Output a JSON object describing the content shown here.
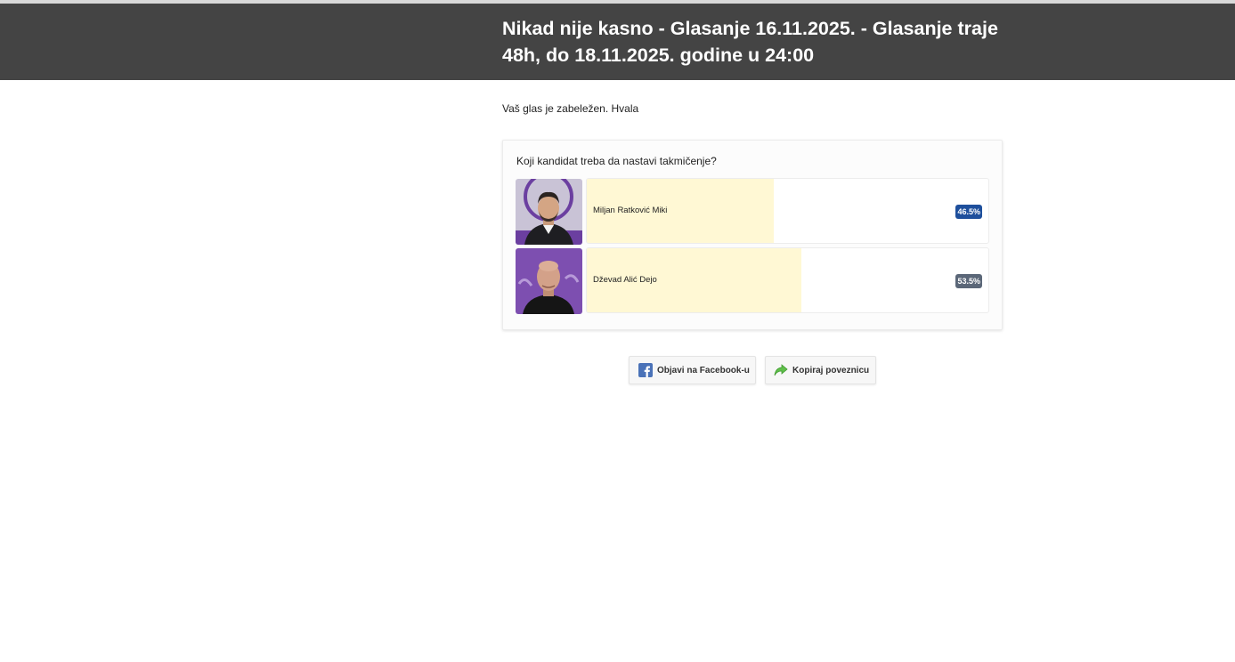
{
  "header": {
    "title": "Nikad nije kasno - Glasanje 16.11.2025. - Glasanje traje 48h, do 18.11.2025. godine u 24:00"
  },
  "vote_message": "Vaš glas je zabeležen. Hvala",
  "poll": {
    "question": "Koji kandidat treba da nastavi takmičenje?",
    "options": [
      {
        "name": "Miljan Ratković Miki",
        "percent_label": "46.5%",
        "share": 0.465,
        "badge_color": "#1e4f9c"
      },
      {
        "name": "Dževad Alić Dejo",
        "percent_label": "53.5%",
        "share": 0.535,
        "badge_color": "#5b6778"
      }
    ]
  },
  "actions": {
    "facebook_label": "Objavi na Facebook-u",
    "copy_label": "Kopiraj poveznicu"
  },
  "colors": {
    "header_bg": "#444444",
    "bar_fill": "#fff8d4"
  },
  "icons": {
    "facebook": "facebook-icon",
    "copy": "share-arrow-icon"
  }
}
